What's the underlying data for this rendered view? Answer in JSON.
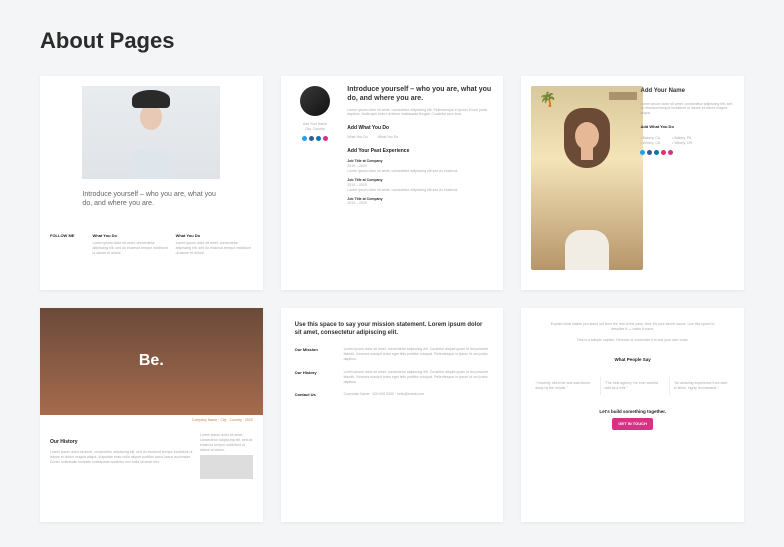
{
  "page": {
    "title": "About Pages"
  },
  "cards": {
    "c1": {
      "intro": "Introduce yourself – who you are, what you do, and where you are.",
      "follow": "FOLLOW ME",
      "col1_h": "What You Do",
      "col2_h": "What You Do",
      "col_body": "Lorem ipsum dolor sit amet, consectetur adipiscing elit, sed do eiusmod tempor incididunt ut labore et dolore."
    },
    "c2": {
      "intro": "Introduce yourself – who you are, what you do, and where you are.",
      "body": "Lorem ipsum dolor sit amet, consectetur adipiscing elit. Pellentesque in ipsum id orci porta dapibus. Nulla quis lorem ut libero malesuada feugiat. Curabitur arcu erat.",
      "section1": "Add What You Do",
      "whatyoudo": "What You Do",
      "section2": "Add Your Past Experience",
      "job_title": "Job Title at Company",
      "dates": "2019 – 2020",
      "job_body": "Lorem ipsum dolor sit amet, consectetur adipiscing elit sed do eiusmod.",
      "name_label": "Add Your Name",
      "location": "City, Country"
    },
    "c3": {
      "name": "Add Your Name",
      "body": "Lorem ipsum dolor sit amet, consectetur adipiscing elit, sed do eiusmod tempor incididunt ut labore et dolore magna aliqua.",
      "section": "Add What You Do",
      "li1": "• Bakery, CA",
      "li2": "• Winery, CA",
      "li3": "• Bakery, PA",
      "li4": "• Winery, OR"
    },
    "c4": {
      "be": "Be.",
      "caption": "Company Name · City · Country · 2020",
      "section": "Our History",
      "body": "Lorem ipsum dolor sit amet, consectetur adipiscing elit, sed do eiusmod tempor incididunt ut labore et dolore magna aliqua. Vulputate enim nulla aliquet porttitor lacus luctus accumsan. Donec sollicitudin molestie malesuada curabitur non nulla sit amet nisl."
    },
    "c5": {
      "heading": "Use this space to say your mission statement. Lorem ipsum dolor sit amet, consectetur adipiscing elit.",
      "l1": "Our Mission",
      "l2": "Our History",
      "l3": "Contact Us",
      "body": "Lorem ipsum dolor sit amet, consectetur adipiscing elit. Curabitur aliquet quam id dui posuere blandit. Vivamus suscipit tortor eget felis porttitor volutpat. Pellentesque in ipsum id orci porta dapibus.",
      "contact": "Corporate Name · 000 000 0000 · hello@email.com"
    },
    "c6": {
      "top": "Explain what makes you stand out from the rest of the pack. Hint: it's your secret sauce. Use this space to describe it — make it count.",
      "top2": "This is a sample caption. Remove or customize it to suit your own voice.",
      "quotes_h": "What People Say",
      "q1": "\"I recently hired her and was blown away by the results.\"",
      "q2": "\"The best agency I've ever worked with by a mile.\"",
      "q3": "\"An amazing experience from start to finish, highly recommend.\"",
      "cta_h": "Let's build something together.",
      "cta_btn": "GET IN TOUCH"
    }
  }
}
